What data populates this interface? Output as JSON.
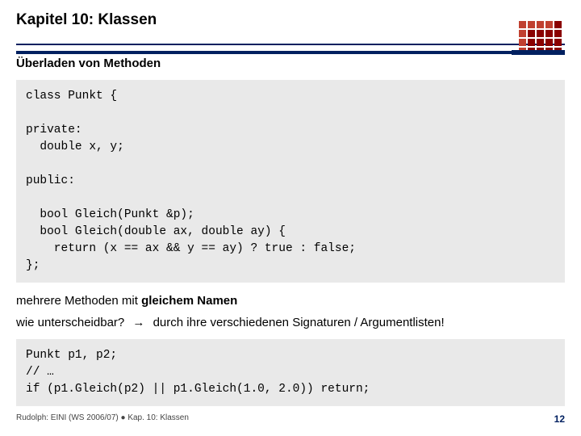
{
  "header": {
    "chapter_title": "Kapitel 10: Klassen"
  },
  "section": {
    "subtitle": "Überladen von Methoden"
  },
  "code1": {
    "l1": "class Punkt {",
    "l2": "",
    "l3": "private:",
    "l4": "  double x, y;",
    "l5": "",
    "l6": "public:",
    "l7": "",
    "l8": "  bool Gleich(Punkt &p);",
    "l9": "  bool Gleich(double ax, double ay) {",
    "l10": "    return (x == ax && y == ay) ? true : false;",
    "l11": "};"
  },
  "explain": {
    "line1_a": "mehrere Methoden mit ",
    "line1_b": "gleichem Namen",
    "line2_q": "wie unterscheidbar?",
    "arrow": "→",
    "line2_a": "durch ihre verschiedenen Signaturen / Argumentlisten!"
  },
  "code2": {
    "l1": "Punkt p1, p2;",
    "l2": "// …",
    "l3": "if (p1.Gleich(p2) || p1.Gleich(1.0, 2.0)) return;"
  },
  "footer": {
    "text": "Rudolph: EINI (WS 2006/07)  ●  Kap. 10: Klassen",
    "page": "12"
  }
}
